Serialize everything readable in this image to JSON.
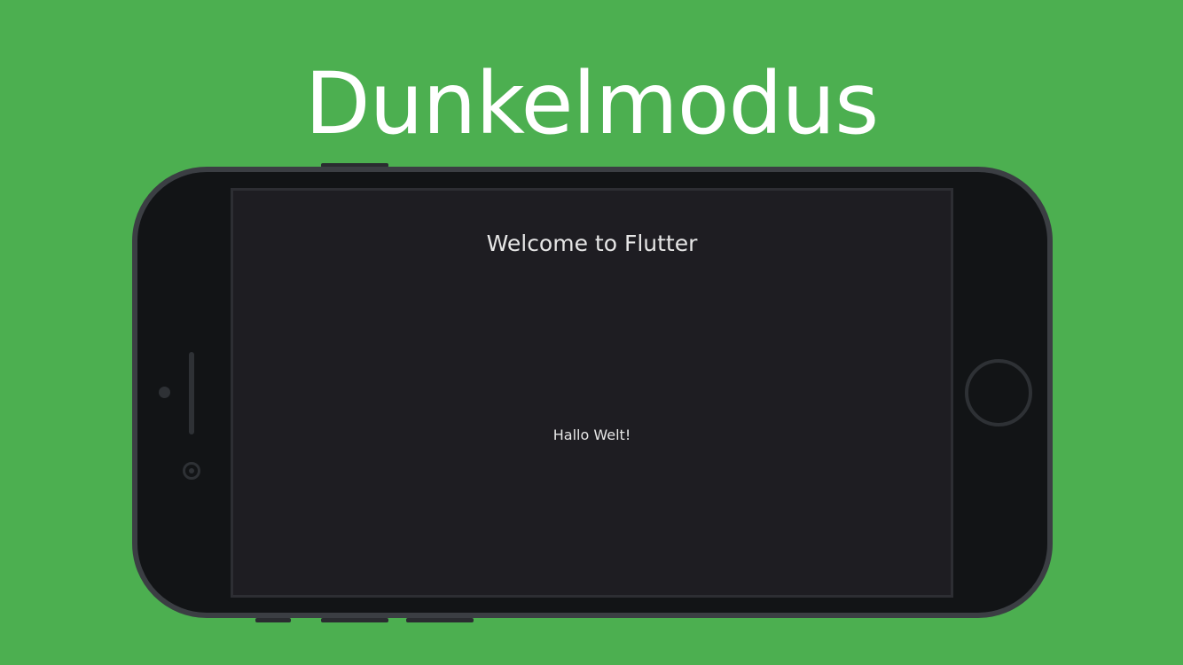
{
  "headline": "Dunkelmodus",
  "app": {
    "title": "Welcome to Flutter",
    "body_text": "Hallo Welt!"
  },
  "colors": {
    "background": "#4caf50",
    "phone_frame": "#3b3e43",
    "phone_body": "#121416",
    "screen": "#1e1d22",
    "text": "#e6e6e6"
  }
}
